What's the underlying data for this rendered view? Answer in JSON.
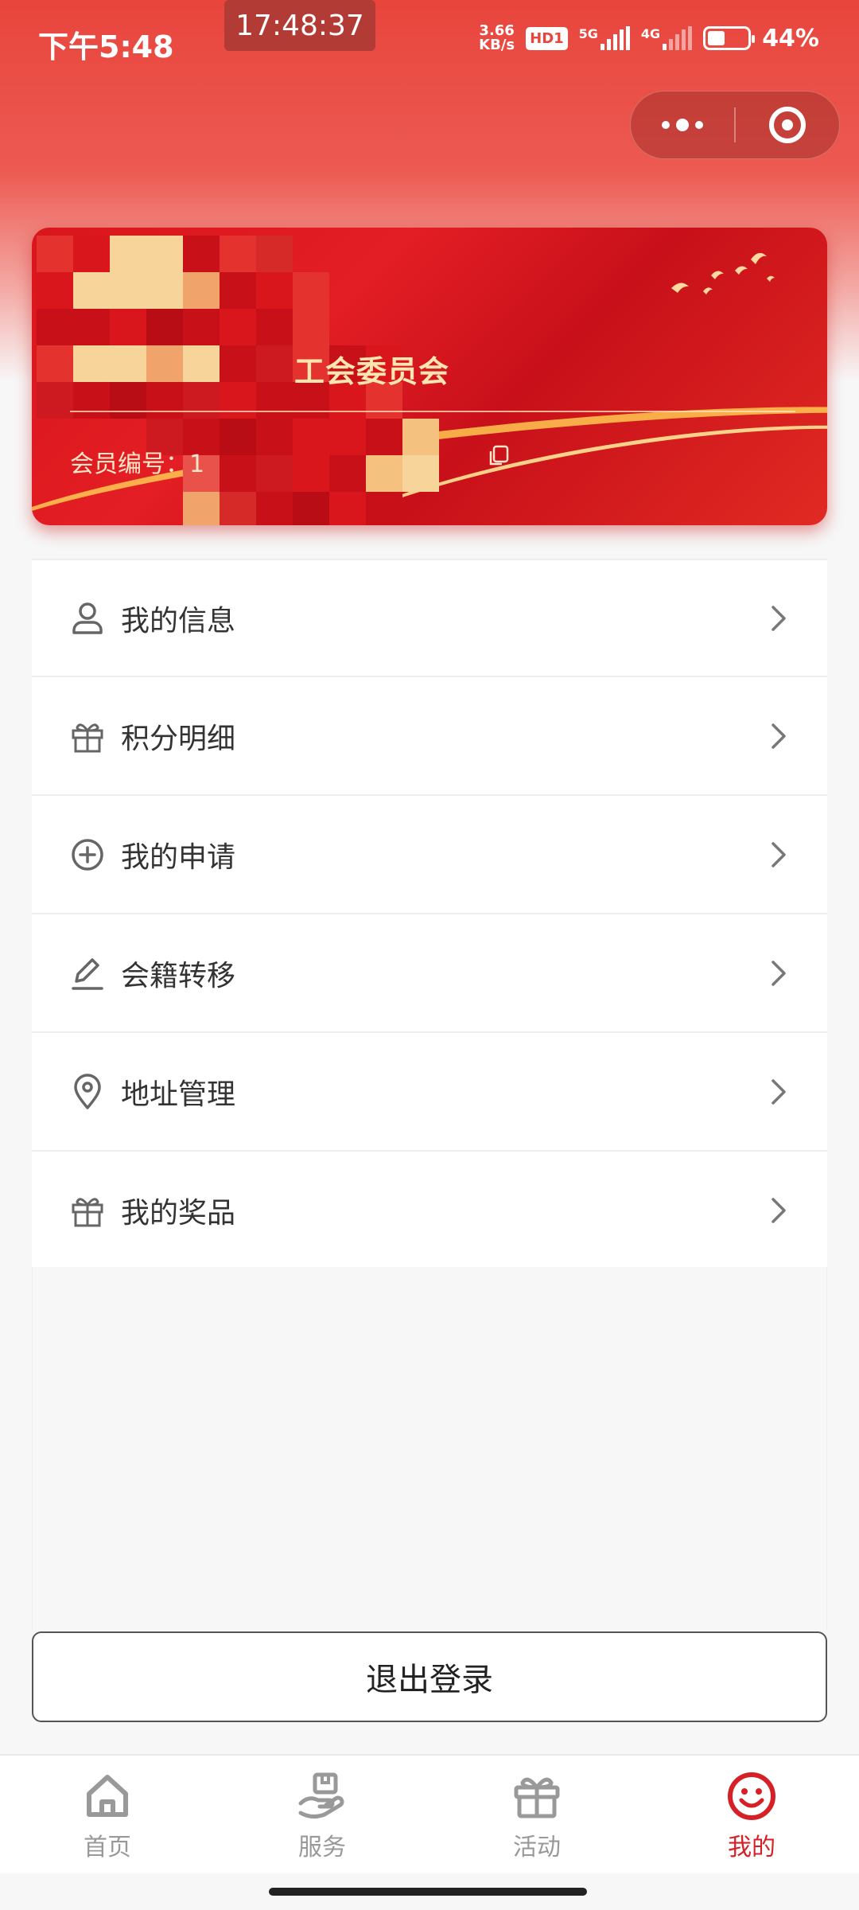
{
  "status_bar": {
    "time": "下午5:48",
    "clock_overlay": "17:48:37",
    "net_speed_value": "3.66",
    "net_speed_unit": "KB/s",
    "hd_badge": "HD1",
    "signal1_label": "5G",
    "signal2_label": "4G",
    "battery_percent": "44%",
    "battery_level": 0.44
  },
  "capsule": {
    "more_icon": "more-dots-icon",
    "close_icon": "target-close-icon"
  },
  "member_card": {
    "org_name": "工会委员会",
    "member_no_label": "会员编号：",
    "member_no_value": "1",
    "copy_icon": "copy-icon"
  },
  "menu": {
    "items": [
      {
        "label": "我的信息",
        "icon": "person-icon"
      },
      {
        "label": "积分明细",
        "icon": "gift-icon"
      },
      {
        "label": "我的申请",
        "icon": "plus-circle-icon"
      },
      {
        "label": "会籍转移",
        "icon": "pencil-icon"
      },
      {
        "label": "地址管理",
        "icon": "location-pin-icon"
      },
      {
        "label": "我的奖品",
        "icon": "gift-icon"
      }
    ]
  },
  "logout": {
    "label": "退出登录"
  },
  "tabs": [
    {
      "label": "首页",
      "icon": "home-icon",
      "active": false
    },
    {
      "label": "服务",
      "icon": "service-hand-icon",
      "active": false
    },
    {
      "label": "活动",
      "icon": "gift-box-icon",
      "active": false
    },
    {
      "label": "我的",
      "icon": "smiley-icon",
      "active": true
    }
  ],
  "colors": {
    "brand_red": "#d71f26",
    "header_red": "#e8453c",
    "card_gold": "#ffe6b0",
    "inactive_gray": "#999999"
  }
}
